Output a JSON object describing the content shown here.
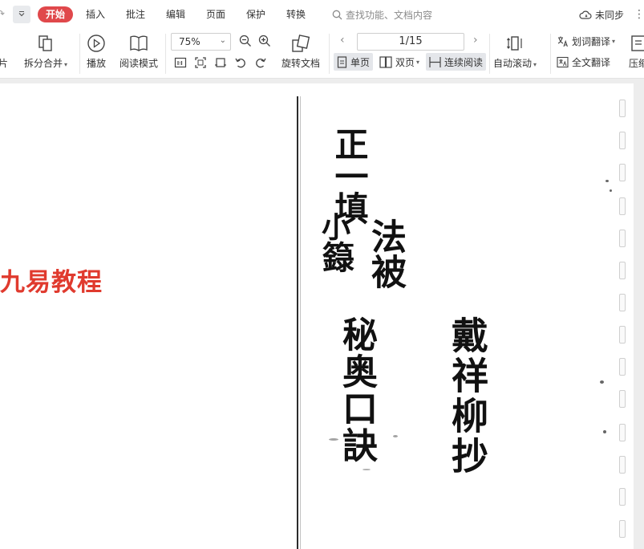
{
  "menubar": {
    "tabs": [
      "开始",
      "插入",
      "批注",
      "编辑",
      "页面",
      "保护",
      "转换"
    ],
    "active_tab": "开始",
    "search_placeholder": "查找功能、文档内容",
    "sync_status": "未同步"
  },
  "toolbar": {
    "left_partial_label": "片",
    "split_merge": "拆分合并",
    "play": "播放",
    "reading_mode": "阅读模式",
    "zoom": "75%",
    "rotate_doc": "旋转文档",
    "page_indicator": "1/15",
    "single_page": "单页",
    "double_page": "双页",
    "continuous_read": "连续阅读",
    "auto_scroll": "自动滚动",
    "word_translate": "划词翻译",
    "full_translate": "全文翻译",
    "compress_partial": "压缩"
  },
  "document": {
    "watermark": "九易教程",
    "title_col1": "正一填",
    "title_col2_a": "小",
    "title_col2_b": "籙",
    "title_col3": "法被",
    "title_col_main": "秘奥口訣",
    "author": "戴祥柳抄"
  },
  "colors": {
    "accent": "#e0484b",
    "watermark": "#e03a2e",
    "selected_mode_bg": "#e4e6ea"
  }
}
